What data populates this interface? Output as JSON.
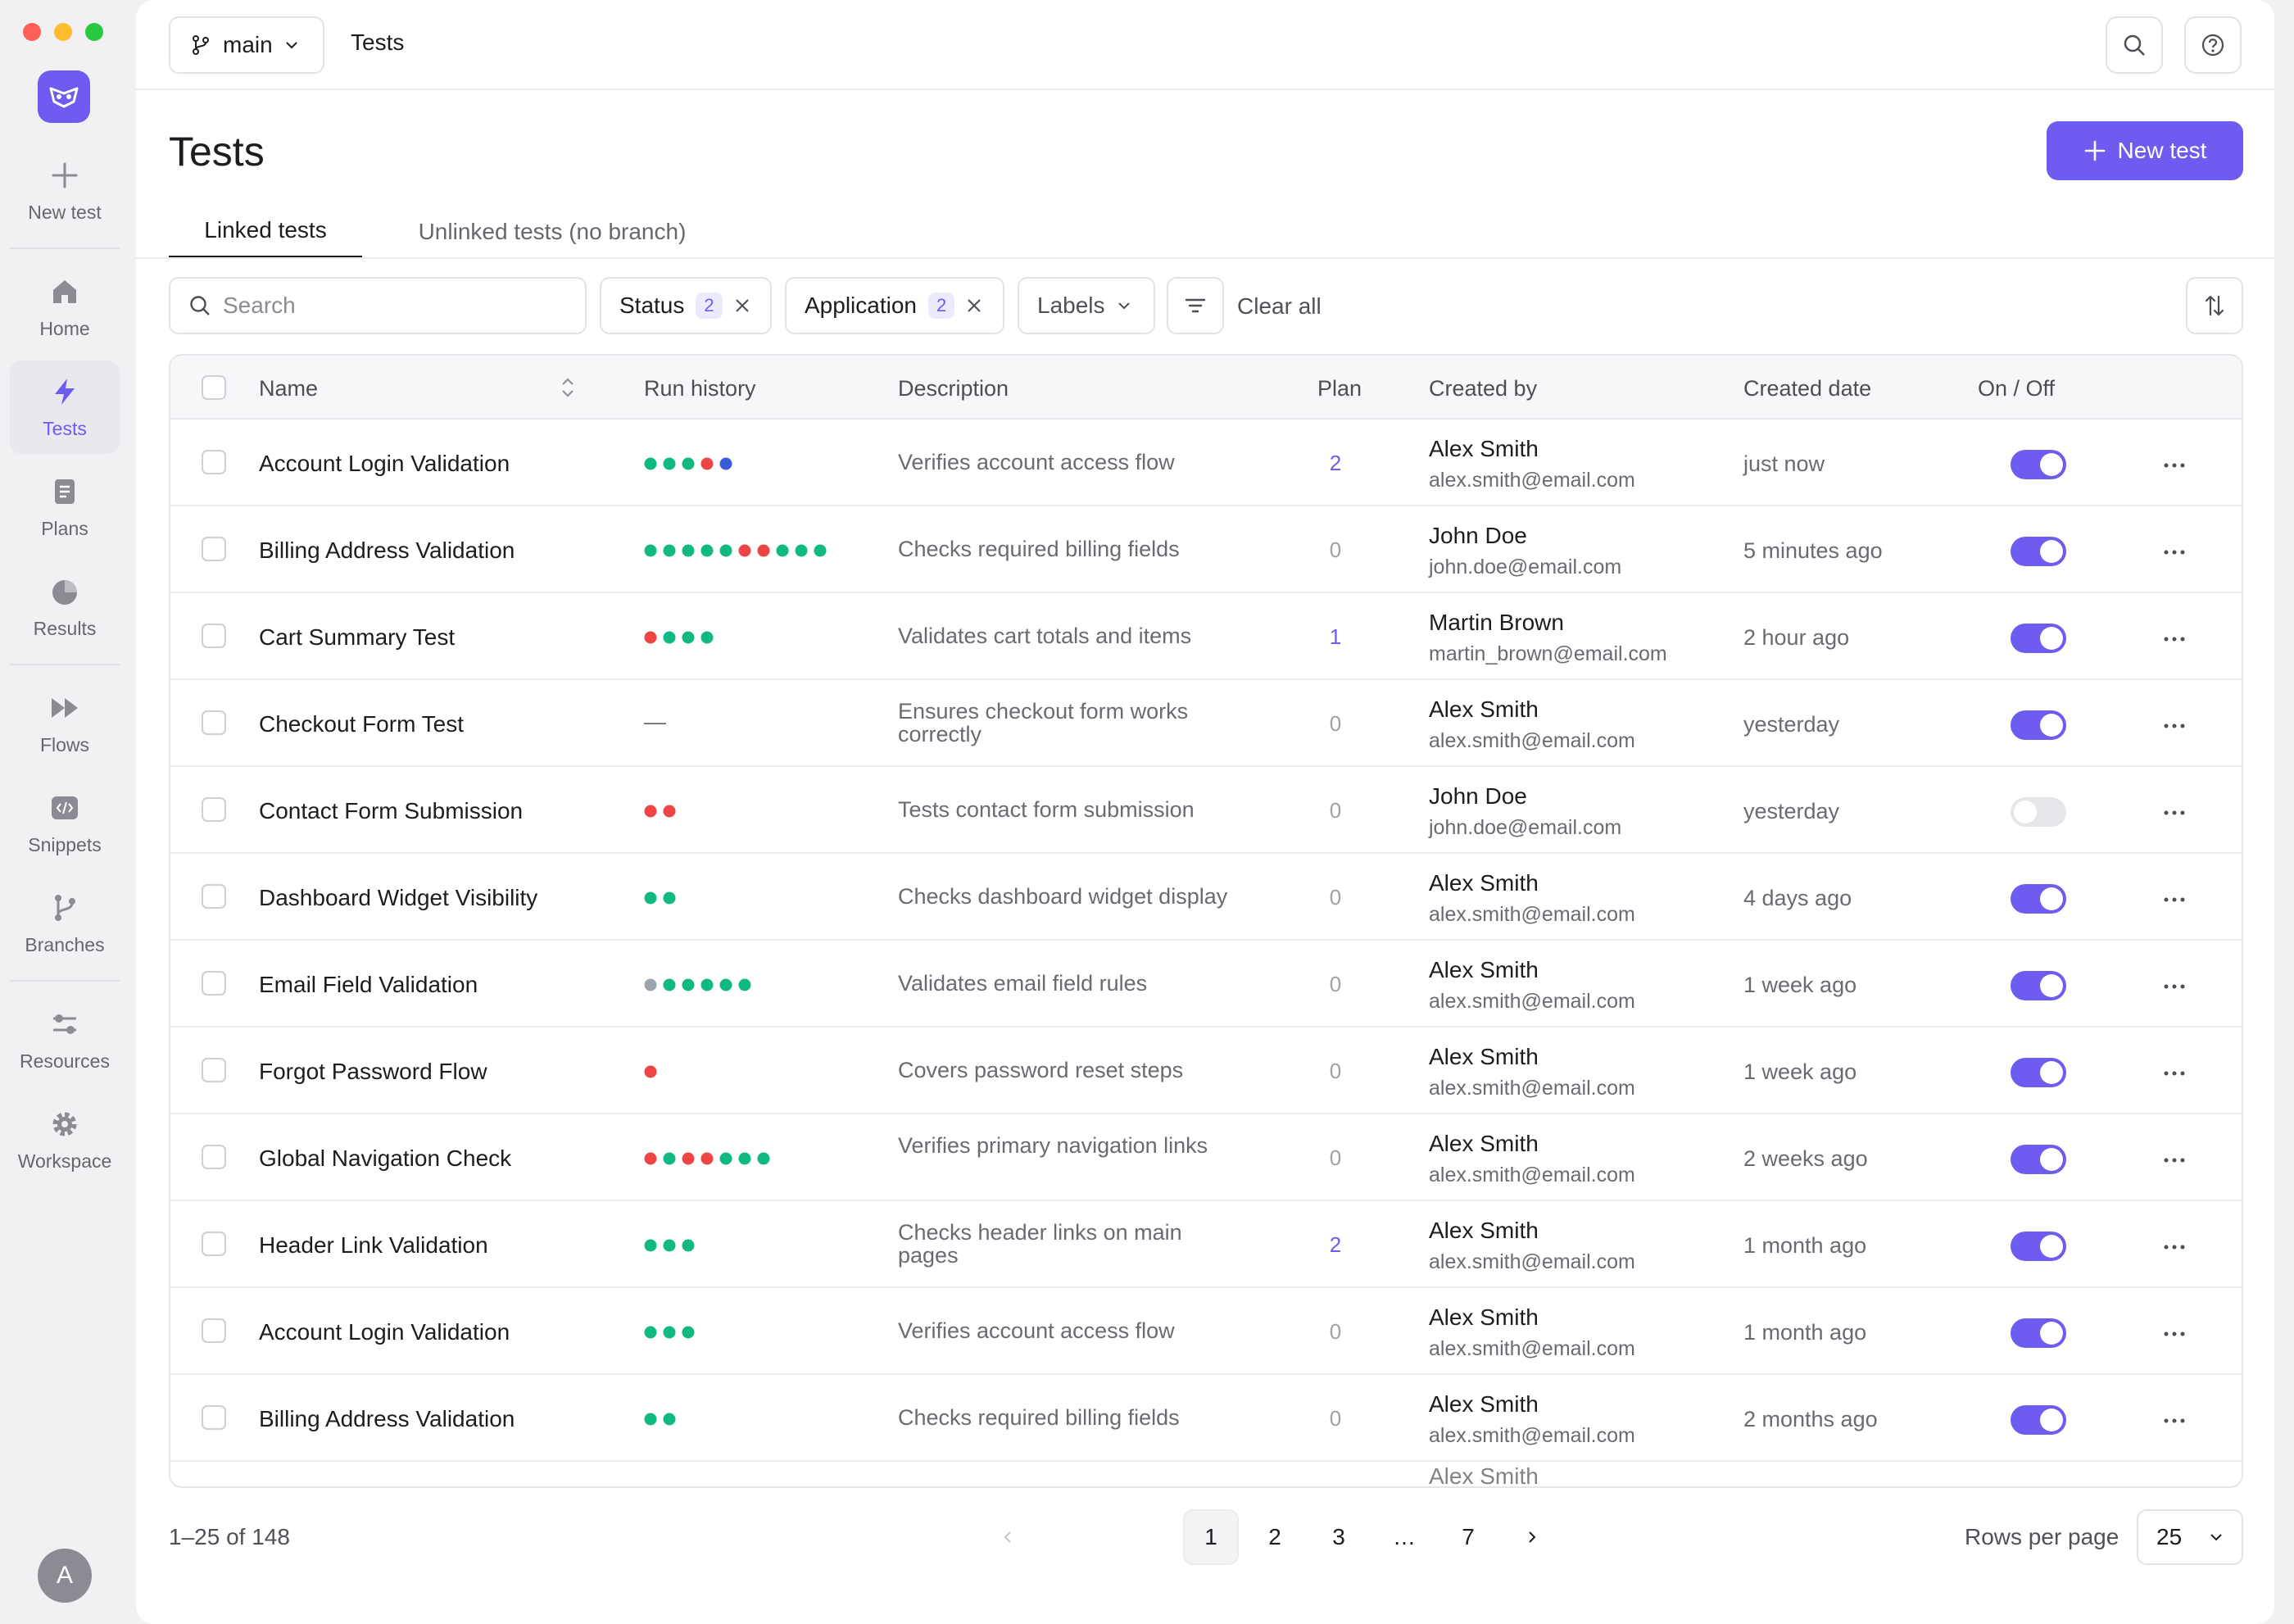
{
  "rail": {
    "items": [
      {
        "label": "New test",
        "icon": "plus-icon"
      },
      {
        "label": "Home",
        "icon": "home-icon"
      },
      {
        "label": "Tests",
        "icon": "lightning-icon"
      },
      {
        "label": "Plans",
        "icon": "document-icon"
      },
      {
        "label": "Results",
        "icon": "pie-chart-icon"
      },
      {
        "label": "Flows",
        "icon": "fast-forward-icon"
      },
      {
        "label": "Snippets",
        "icon": "code-icon"
      },
      {
        "label": "Branches",
        "icon": "git-branch-icon"
      },
      {
        "label": "Resources",
        "icon": "sliders-icon"
      },
      {
        "label": "Workspace",
        "icon": "gear-icon"
      }
    ],
    "avatar": "A"
  },
  "topbar": {
    "branch": "main",
    "title": "Tests"
  },
  "header": {
    "title": "Tests",
    "new_button": "New test"
  },
  "tabs": [
    "Linked tests",
    "Unlinked tests (no branch)"
  ],
  "filters": {
    "search_placeholder": "Search",
    "status_label": "Status",
    "status_count": "2",
    "application_label": "Application",
    "application_count": "2",
    "labels_label": "Labels",
    "clear_all": "Clear all"
  },
  "columns": [
    "Name",
    "Run history",
    "Description",
    "Plan",
    "Created by",
    "Created date",
    "On / Off"
  ],
  "colors": {
    "pass": "#10b981",
    "fail": "#ef4444",
    "running": "#3b5bdb",
    "skipped": "#9ca3af",
    "accent": "#6e5bf0"
  },
  "rows": [
    {
      "name": "Account Login Validation",
      "runs": [
        "pass",
        "pass",
        "pass",
        "fail",
        "running"
      ],
      "desc": "Verifies account access flow",
      "plan": "2",
      "creator": "Alex Smith",
      "email": "alex.smith@email.com",
      "date": "just now",
      "on": true
    },
    {
      "name": "Billing Address Validation",
      "runs": [
        "pass",
        "pass",
        "pass",
        "pass",
        "pass",
        "fail",
        "fail",
        "pass",
        "pass",
        "pass"
      ],
      "desc": "Checks required billing fields",
      "plan": "0",
      "creator": "John Doe",
      "email": "john.doe@email.com",
      "date": "5 minutes ago",
      "on": true
    },
    {
      "name": "Cart Summary Test",
      "runs": [
        "fail",
        "pass",
        "pass",
        "pass"
      ],
      "desc": "Validates cart totals and items",
      "plan": "1",
      "creator": "Martin Brown",
      "email": "martin_brown@email.com",
      "date": "2 hour ago",
      "on": true
    },
    {
      "name": "Checkout Form Test",
      "runs": [],
      "runs_empty": "—",
      "desc": "Ensures checkout form works correctly",
      "plan": "0",
      "creator": "Alex Smith",
      "email": "alex.smith@email.com",
      "date": "yesterday",
      "on": true
    },
    {
      "name": "Contact Form Submission",
      "runs": [
        "fail",
        "fail"
      ],
      "desc": "Tests contact form submission",
      "plan": "0",
      "creator": "John Doe",
      "email": "john.doe@email.com",
      "date": "yesterday",
      "on": false
    },
    {
      "name": "Dashboard Widget Visibility",
      "runs": [
        "pass",
        "pass"
      ],
      "desc": "Checks dashboard widget display",
      "plan": "0",
      "creator": "Alex Smith",
      "email": "alex.smith@email.com",
      "date": "4 days ago",
      "on": true
    },
    {
      "name": "Email Field Validation",
      "runs": [
        "skipped",
        "pass",
        "pass",
        "pass",
        "pass",
        "pass"
      ],
      "desc": "Validates email field rules",
      "plan": "0",
      "creator": "Alex Smith",
      "email": "alex.smith@email.com",
      "date": "1 week ago",
      "on": true
    },
    {
      "name": "Forgot Password Flow",
      "runs": [
        "fail"
      ],
      "desc": "Covers password reset steps",
      "plan": "0",
      "creator": "Alex Smith",
      "email": "alex.smith@email.com",
      "date": "1 week ago",
      "on": true
    },
    {
      "name": "Global Navigation Check",
      "runs": [
        "fail",
        "pass",
        "fail",
        "fail",
        "pass",
        "pass",
        "pass"
      ],
      "desc": "Verifies primary navigation links",
      "plan": "0",
      "creator": "Alex Smith",
      "email": "alex.smith@email.com",
      "date": "2 weeks ago",
      "on": true
    },
    {
      "name": "Header Link Validation",
      "runs": [
        "pass",
        "pass",
        "pass"
      ],
      "desc": "Checks header links on main pages",
      "plan": "2",
      "creator": "Alex Smith",
      "email": "alex.smith@email.com",
      "date": "1 month ago",
      "on": true
    },
    {
      "name": "Account Login Validation",
      "runs": [
        "pass",
        "pass",
        "pass"
      ],
      "desc": "Verifies account access flow",
      "plan": "0",
      "creator": "Alex Smith",
      "email": "alex.smith@email.com",
      "date": "1 month ago",
      "on": true
    },
    {
      "name": "Billing Address Validation",
      "runs": [
        "pass",
        "pass"
      ],
      "desc": "Checks required billing fields",
      "plan": "0",
      "creator": "Alex Smith",
      "email": "alex.smith@email.com",
      "date": "2 months ago",
      "on": true
    }
  ],
  "partial_row_creator": "Alex Smith",
  "footer": {
    "range": "1–25 of 148",
    "pages": [
      "1",
      "2",
      "3",
      "…",
      "7"
    ],
    "current_page": "1",
    "rows_per_page_label": "Rows per page",
    "rows_per_page": "25"
  }
}
